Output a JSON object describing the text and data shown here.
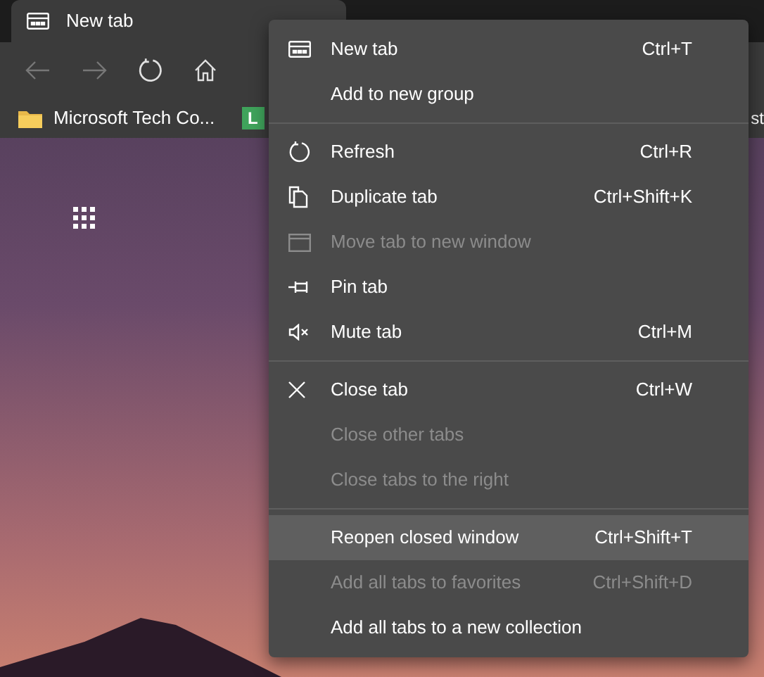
{
  "tab": {
    "title": "New tab"
  },
  "bookmarks": [
    {
      "label": "Microsoft Tech Co..."
    },
    {
      "label": "L"
    },
    {
      "label": "st"
    }
  ],
  "context_menu": {
    "groups": [
      [
        {
          "label": "New tab",
          "shortcut": "Ctrl+T",
          "disabled": false,
          "selected": false
        },
        {
          "label": "Add to new group",
          "disabled": false,
          "selected": false
        }
      ],
      [
        {
          "label": "Refresh",
          "shortcut": "Ctrl+R",
          "disabled": false,
          "selected": false
        },
        {
          "label": "Duplicate tab",
          "shortcut": "Ctrl+Shift+K",
          "disabled": false,
          "selected": false
        },
        {
          "label": "Move tab to new window",
          "disabled": true,
          "selected": false
        },
        {
          "label": "Pin tab",
          "disabled": false,
          "selected": false
        },
        {
          "label": "Mute tab",
          "shortcut": "Ctrl+M",
          "disabled": false,
          "selected": false
        }
      ],
      [
        {
          "label": "Close tab",
          "shortcut": "Ctrl+W",
          "disabled": false,
          "selected": false
        },
        {
          "label": "Close other tabs",
          "disabled": true,
          "selected": false
        },
        {
          "label": "Close tabs to the right",
          "disabled": true,
          "selected": false
        }
      ],
      [
        {
          "label": "Reopen closed window",
          "shortcut": "Ctrl+Shift+T",
          "disabled": false,
          "selected": true
        },
        {
          "label": "Add all tabs to favorites",
          "shortcut": "Ctrl+Shift+D",
          "disabled": true,
          "selected": false
        },
        {
          "label": "Add all tabs to a new collection",
          "disabled": false,
          "selected": false
        }
      ]
    ]
  }
}
